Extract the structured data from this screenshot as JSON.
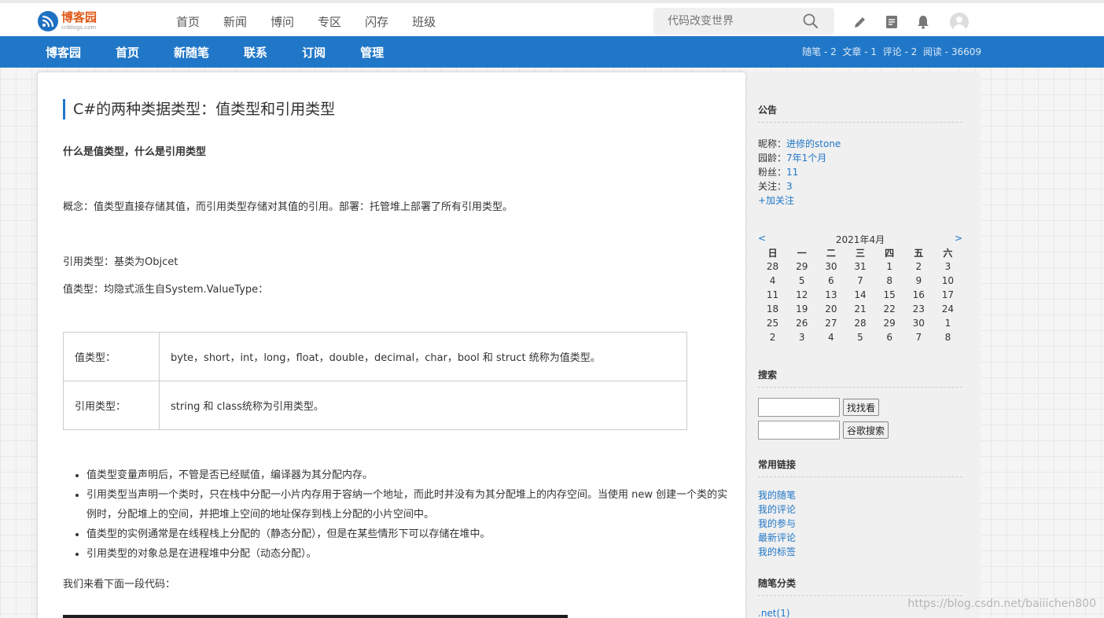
{
  "site": {
    "logo_text": "博客园",
    "logo_sub": "cnblogs.com",
    "nav": [
      "首页",
      "新闻",
      "博问",
      "专区",
      "闪存",
      "班级"
    ],
    "search_placeholder": "代码改变世界"
  },
  "blog_nav": {
    "items": [
      "博客园",
      "首页",
      "新随笔",
      "联系",
      "订阅",
      "管理"
    ],
    "stats": "随笔 - 2  文章 - 1  评论 - 2  阅读 - 36609"
  },
  "post": {
    "title": "C#的两种类据类型：值类型和引用类型",
    "heading": "什么是值类型，什么是引用类型",
    "concept": "概念：值类型直接存储其值，而引用类型存储对其值的引用。部署：托管堆上部署了所有引用类型。",
    "ref_base": "引用类型：基类为Objcet",
    "val_base": "值类型：均隐式派生自System.ValueType：",
    "table": [
      {
        "label": "值类型：",
        "value": "byte，short，int，long，float，double，decimal，char，bool 和 struct 统称为值类型。"
      },
      {
        "label": "引用类型：",
        "value": "string 和 class统称为引用类型。"
      }
    ],
    "bullets": [
      "值类型变量声明后，不管是否已经赋值，编译器为其分配内存。",
      "引用类型当声明一个类时，只在栈中分配一小片内存用于容纳一个地址，而此时并没有为其分配堆上的内存空间。当使用 new 创建一个类的实例时，分配堆上的空间，并把堆上空间的地址保存到栈上分配的小片空间中。",
      "值类型的实例通常是在线程栈上分配的（静态分配），但是在某些情形下可以存储在堆中。",
      "引用类型的对象总是在进程堆中分配（动态分配）。"
    ],
    "code_intro": "我们来看下面一段代码："
  },
  "sidebar": {
    "notice_title": "公告",
    "profile": [
      {
        "label": "昵称：",
        "value": "进修的stone"
      },
      {
        "label": "园龄：",
        "value": "7年1个月"
      },
      {
        "label": "粉丝：",
        "value": "11"
      },
      {
        "label": "关注：",
        "value": "3"
      }
    ],
    "follow": "+加关注",
    "calendar": {
      "prev": "<",
      "month": "2021年4月",
      "next": ">",
      "weekdays": [
        "日",
        "一",
        "二",
        "三",
        "四",
        "五",
        "六"
      ],
      "weeks": [
        [
          "28",
          "29",
          "30",
          "31",
          "1",
          "2",
          "3"
        ],
        [
          "4",
          "5",
          "6",
          "7",
          "8",
          "9",
          "10"
        ],
        [
          "11",
          "12",
          "13",
          "14",
          "15",
          "16",
          "17"
        ],
        [
          "18",
          "19",
          "20",
          "21",
          "22",
          "23",
          "24"
        ],
        [
          "25",
          "26",
          "27",
          "28",
          "29",
          "30",
          "1"
        ],
        [
          "2",
          "3",
          "4",
          "5",
          "6",
          "7",
          "8"
        ]
      ]
    },
    "search_title": "搜索",
    "search_btn": "找找看",
    "google_btn": "谷歌搜索",
    "links_title": "常用链接",
    "links": [
      "我的随笔",
      "我的评论",
      "我的参与",
      "最新评论",
      "我的标签"
    ],
    "category_title": "随笔分类",
    "category_first": ".net(1)"
  },
  "watermark": "https://blog.csdn.net/baiiichen800",
  "colors": {
    "accent": "#2177c7",
    "brand_orange": "#e05a18"
  }
}
